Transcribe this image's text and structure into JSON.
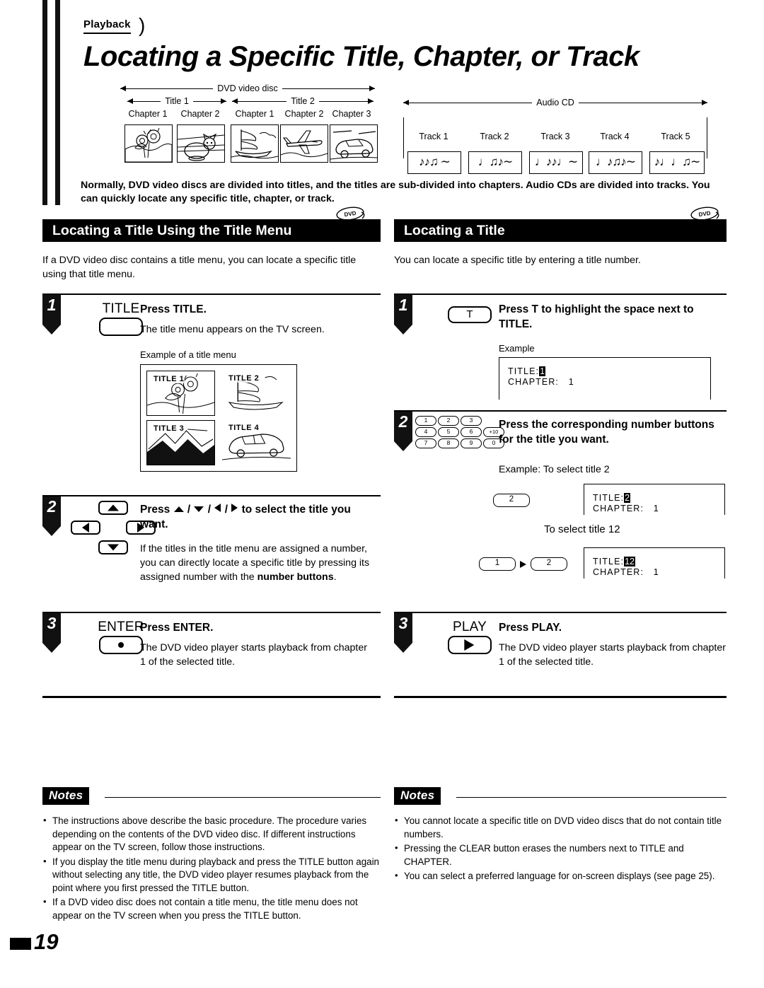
{
  "header": {
    "tag": "Playback",
    "title": "Locating a Specific Title, Chapter, or Track"
  },
  "diagram": {
    "dvd": {
      "span_label": "DVD video disc",
      "titles": [
        {
          "label": "Title 1",
          "chapters": [
            "Chapter 1",
            "Chapter 2"
          ]
        },
        {
          "label": "Title 2",
          "chapters": [
            "Chapter 1",
            "Chapter 2",
            "Chapter 3"
          ]
        }
      ]
    },
    "cd": {
      "span_label": "Audio CD",
      "tracks": [
        {
          "label": "Track 1",
          "notes": "♪♪♫ ∼"
        },
        {
          "label": "Track 2",
          "notes": "♩♫♪∼"
        },
        {
          "label": "Track 3",
          "notes": "♩♪♪♩∼"
        },
        {
          "label": "Track 4",
          "notes": "♩♪♫♪∼"
        },
        {
          "label": "Track 5",
          "notes": "♪♩♩♫∼"
        }
      ]
    }
  },
  "intro": "Normally, DVD video discs are divided into titles, and the titles are sub-divided into chapters. Audio CDs are divided into tracks. You can quickly locate any specific title, chapter, or track.",
  "left_section": {
    "heading": "Locating a Title Using the Title Menu",
    "badge_label": "DVD",
    "lede": "If a DVD video disc contains a title menu, you can locate a specific title using that title menu.",
    "steps": [
      {
        "number": "1",
        "key_label": "TITLE",
        "title": "Press TITLE.",
        "desc": "The title menu appears on the TV screen.",
        "example_caption": "Example of a title menu",
        "menu_items": [
          "TITLE 1",
          "TITLE 2",
          "TITLE 3",
          "TITLE 4"
        ]
      },
      {
        "number": "2",
        "title_prefix": "Press",
        "title_suffix": "to select the title you want.",
        "desc_1": "If the titles in the title menu are assigned a number, you can directly locate a specific title by pressing its assigned number with the ",
        "desc_bold": "number buttons",
        "desc_2": "."
      },
      {
        "number": "3",
        "key_label": "ENTER",
        "title": "Press ENTER.",
        "desc": "The DVD video player starts playback from chapter 1 of the selected title."
      }
    ],
    "notes_label": "Notes",
    "notes": [
      "The instructions above describe the basic procedure. The procedure varies depending on the contents of the DVD video disc. If different instructions appear on the TV screen, follow those instructions.",
      "If you display the title menu during playback and press the TITLE button again without selecting any title, the DVD video player resumes playback from the point where you first pressed the TITLE button.",
      "If a DVD video disc does not contain a title menu, the title menu does not appear on the TV screen when you press the TITLE button."
    ]
  },
  "right_section": {
    "heading": "Locating a Title",
    "badge_label": "DVD",
    "lede": "You can locate a specific title by entering a title number.",
    "steps": [
      {
        "number": "1",
        "key_label": "T",
        "title": "Press T to highlight the space next to TITLE.",
        "example_caption": "Example",
        "osd": {
          "title_label": "TITLE:",
          "title_value": "1",
          "chapter_label": "CHAPTER:",
          "chapter_value": "1"
        }
      },
      {
        "number": "2",
        "title": "Press the corresponding number buttons for the title you want.",
        "numpad": [
          [
            "1",
            "2",
            "3"
          ],
          [
            "4",
            "5",
            "6",
            "+10"
          ],
          [
            "7",
            "8",
            "9",
            "0"
          ]
        ],
        "example_caption": "Example: To select title 2",
        "example_1": {
          "keys": [
            "2"
          ],
          "osd": {
            "title_label": "TITLE:",
            "title_value": "2",
            "chapter_label": "CHAPTER:",
            "chapter_value": "1"
          }
        },
        "mid_caption": "To select title 12",
        "example_2": {
          "keys": [
            "1",
            "2"
          ],
          "osd": {
            "title_label": "TITLE:",
            "title_value": "12",
            "chapter_label": "CHAPTER:",
            "chapter_value": "1"
          }
        }
      },
      {
        "number": "3",
        "key_label": "PLAY",
        "title": "Press PLAY.",
        "desc": "The DVD video player starts playback from chapter 1 of the selected title."
      }
    ],
    "notes_label": "Notes",
    "notes": [
      "You cannot locate a specific title on DVD video discs that do not contain title numbers.",
      "Pressing the CLEAR button erases the numbers next to TITLE and CHAPTER.",
      "You can select a preferred language for on-screen displays (see page 25)."
    ]
  },
  "footer": {
    "page_number": "19"
  }
}
